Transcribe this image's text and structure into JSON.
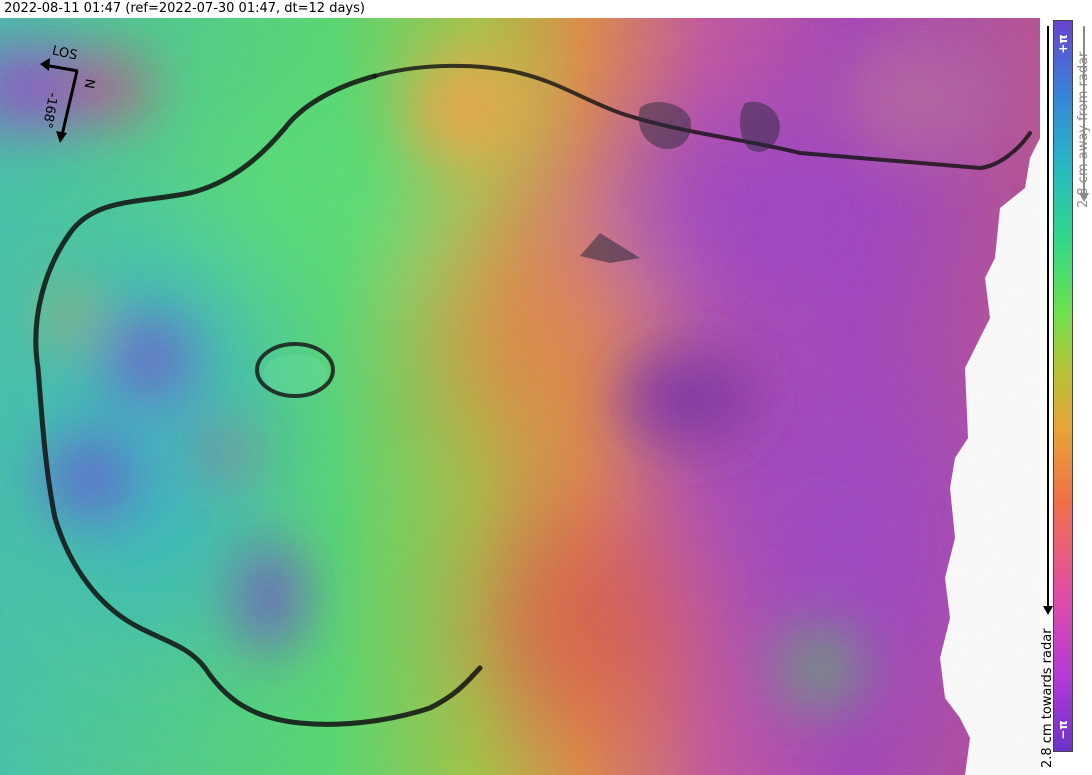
{
  "title": "2022-08-11 01:47 (ref=2022-07-30 01:47, dt=12 days)",
  "compass": {
    "los_label": "LOS",
    "north_label": "N",
    "heading_label": "-168°"
  },
  "colorbar": {
    "top_label": "+π",
    "bottom_label": "−π",
    "away_label": "2.8 cm away from radar",
    "towards_label": "2.8 cm towards radar",
    "colors": [
      "#6b33c8",
      "#e24fa3",
      "#f06f4a",
      "#b7c236",
      "#30d88a",
      "#3a83d9"
    ]
  }
}
